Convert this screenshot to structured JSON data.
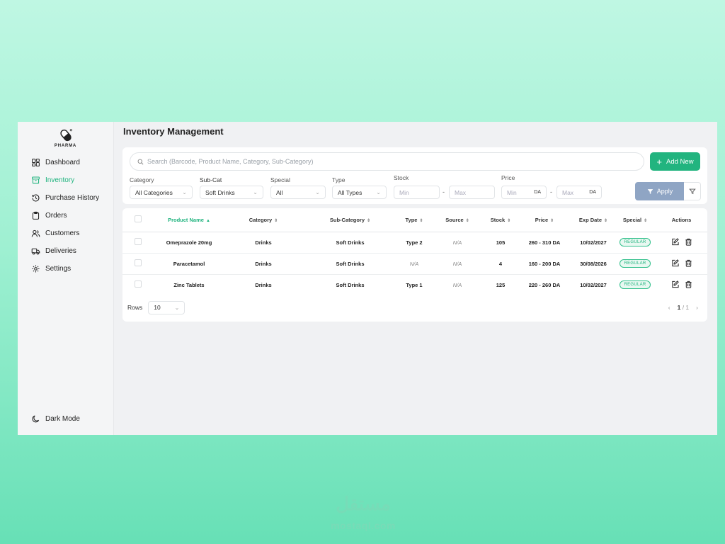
{
  "app": {
    "logo_text": "PHARMA",
    "page_title": "Inventory Management"
  },
  "sidebar": {
    "items": [
      {
        "label": "Dashboard",
        "icon": "grid-icon"
      },
      {
        "label": "Inventory",
        "icon": "archive-icon",
        "active": true
      },
      {
        "label": "Purchase History",
        "icon": "history-icon"
      },
      {
        "label": "Orders",
        "icon": "clipboard-icon"
      },
      {
        "label": "Customers",
        "icon": "users-icon"
      },
      {
        "label": "Deliveries",
        "icon": "truck-icon"
      },
      {
        "label": "Settings",
        "icon": "gear-icon"
      }
    ],
    "dark_mode_label": "Dark Mode"
  },
  "search": {
    "placeholder": "Search (Barcode, Product Name, Category, Sub-Category)"
  },
  "add_new_label": "Add New",
  "filters": {
    "category": {
      "label": "Category",
      "value": "All Categories"
    },
    "subcat": {
      "label": "Sub-Cat",
      "value": "Soft Drinks"
    },
    "special": {
      "label": "Special",
      "value": "All"
    },
    "type": {
      "label": "Type",
      "value": "All Types"
    },
    "stock": {
      "label": "Stock",
      "min_placeholder": "Min",
      "max_placeholder": "Max",
      "separator": "-"
    },
    "price": {
      "label": "Price",
      "min_placeholder": "Min",
      "max_placeholder": "Max",
      "unit": "DA",
      "separator": "-"
    },
    "apply_label": "Apply"
  },
  "table": {
    "headers": [
      "Product Name",
      "Category",
      "Sub-Category",
      "Type",
      "Source",
      "Stock",
      "Price",
      "Exp Date",
      "Special",
      "Actions"
    ],
    "rows": [
      {
        "name": "Omeprazole 20mg",
        "category": "Drinks",
        "subcategory": "Soft Drinks",
        "type": "Type 2",
        "source": "N/A",
        "stock": "105",
        "price": "260 - 310 DA",
        "exp": "10/02/2027",
        "special": "REGULAR"
      },
      {
        "name": "Paracetamol",
        "category": "Drinks",
        "subcategory": "Soft Drinks",
        "type": "N/A",
        "source": "N/A",
        "stock": "4",
        "price": "160 - 200 DA",
        "exp": "30/08/2026",
        "special": "REGULAR"
      },
      {
        "name": "Zinc Tablets",
        "category": "Drinks",
        "subcategory": "Soft Drinks",
        "type": "Type 1",
        "source": "N/A",
        "stock": "125",
        "price": "220 - 260 DA",
        "exp": "10/02/2027",
        "special": "REGULAR"
      }
    ]
  },
  "pagination": {
    "rows_label": "Rows",
    "rows_value": "10",
    "current": "1",
    "total": "/ 1"
  },
  "watermark": {
    "arabic": "مستقل",
    "latin": "mostaql.com"
  },
  "colors": {
    "accent": "#22b47f",
    "apply": "#8fa5c4",
    "background_top": "#bff7e3",
    "background_bottom": "#67e0b6"
  }
}
